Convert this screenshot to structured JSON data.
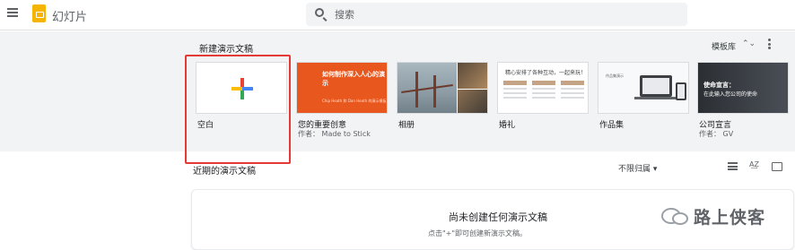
{
  "header": {
    "app_title": "幻灯片",
    "menu_icon": "hamburger-menu-icon",
    "logo_icon": "slides-logo-icon",
    "search": {
      "placeholder": "搜索",
      "value": ""
    }
  },
  "new_section": {
    "title": "新建演示文稿",
    "template_gallery_label": "模板库",
    "sort_glyph": "⌃⌄",
    "colors": {
      "background": "#f1f3f4",
      "highlight_border": "#e53935"
    },
    "templates": [
      {
        "name": "空白",
        "author": ""
      },
      {
        "name": "您的重要创意",
        "author": "作者： Made to Stick",
        "thumb_title": "如何制作深入人心的演示",
        "thumb_sub": "Chip Heath 和 Dan Heath 的演示模板"
      },
      {
        "name": "相册",
        "author": ""
      },
      {
        "name": "婚礼",
        "author": "",
        "thumb_title": "精心安排了各种互动，一起来玩！"
      },
      {
        "name": "作品集",
        "author": "",
        "thumb_label": "作品集演示"
      },
      {
        "name": "公司宣言",
        "author": "作者： GV",
        "thumb_title": "使命宣言：",
        "thumb_sub": "在此输入您公司的使命"
      }
    ]
  },
  "recent_section": {
    "title": "近期的演示文稿",
    "owner_filter": "不限归属 ▾",
    "sort_label": "A͢Z",
    "empty_title": "尚未创建任何演示文稿",
    "empty_sub": "点击\"+\"即可创建新演示文稿。"
  },
  "watermark": {
    "text": "路上侠客",
    "icon": "wechat-icon"
  }
}
